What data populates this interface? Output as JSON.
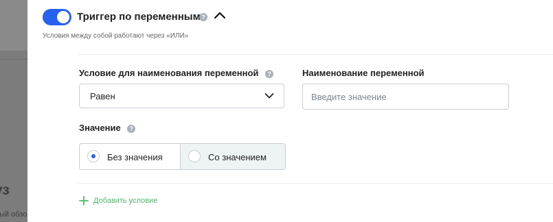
{
  "background_page": {
    "heading_fragment": "уз",
    "text_fragment": "ый обзор"
  },
  "trigger": {
    "enabled": true,
    "title": "Триггер по переменным",
    "subtitle": "Условия между собой работают через «ИЛИ»"
  },
  "condition": {
    "label": "Условие для наименования переменной",
    "selected": "Равен"
  },
  "variable_name": {
    "label": "Наименование переменной",
    "value": "",
    "placeholder": "Введите значение"
  },
  "value": {
    "label": "Значение",
    "options": [
      {
        "label": "Без значения",
        "selected": true
      },
      {
        "label": "Со значением",
        "selected": false
      }
    ]
  },
  "add_condition_label": "Добавить условие",
  "icons": {
    "help": "help-icon",
    "collapse": "chevron-up-icon",
    "dropdown": "chevron-down-icon",
    "add": "plus-icon"
  },
  "colors": {
    "accent": "#2761f0",
    "add_link": "#4bb86b",
    "selected_segment_bg": "#ffffff",
    "unselected_segment_bg": "#eef3f4"
  }
}
